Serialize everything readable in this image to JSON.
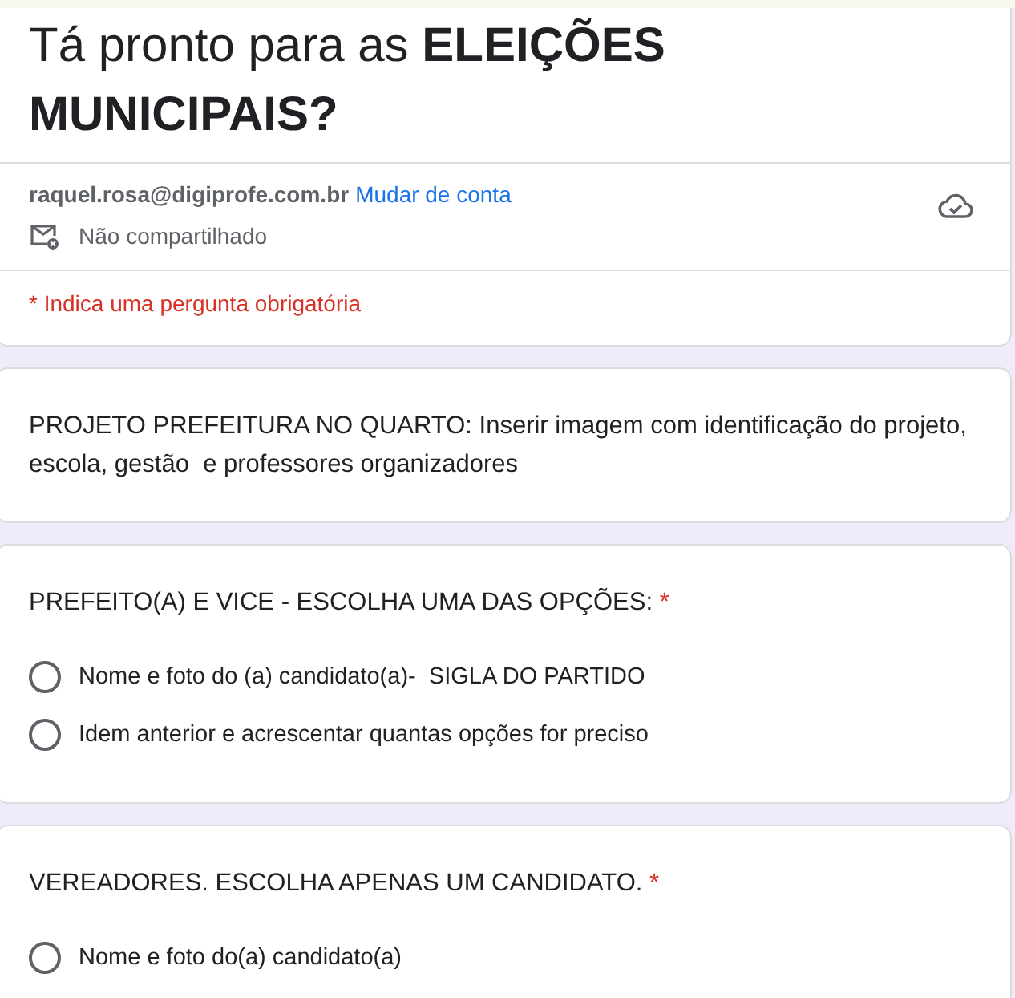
{
  "header": {
    "title": "Tá pronto para as **ELEIÇÕES MUNICIPAIS?**",
    "account_email": "raquel.rosa@digiprofe.com.br",
    "switch_account_link": "Mudar de conta",
    "sharing_status": "Não compartilhado",
    "required_note": "* Indica uma pergunta obrigatória"
  },
  "sections": [
    {
      "kind": "description",
      "text": "PROJETO PREFEITURA NO QUARTO: Inserir imagem com identificação do projeto, escola, gestão  e professores organizadores"
    },
    {
      "kind": "question",
      "title": "PREFEITO(A) E VICE - ESCOLHA UMA DAS OPÇÕES:",
      "required": true,
      "required_mark": "*",
      "options": [
        {
          "label": "Nome e foto do (a) candidato(a)-  SIGLA DO PARTIDO",
          "selected": false
        },
        {
          "label": "Idem anterior e acrescentar quantas opções for preciso",
          "selected": false
        }
      ]
    },
    {
      "kind": "question",
      "title": "VEREADORES. ESCOLHA APENAS UM CANDIDATO.",
      "required": true,
      "required_mark": "*",
      "options": [
        {
          "label": "Nome e foto do(a) candidato(a)",
          "selected": false
        }
      ]
    }
  ]
}
